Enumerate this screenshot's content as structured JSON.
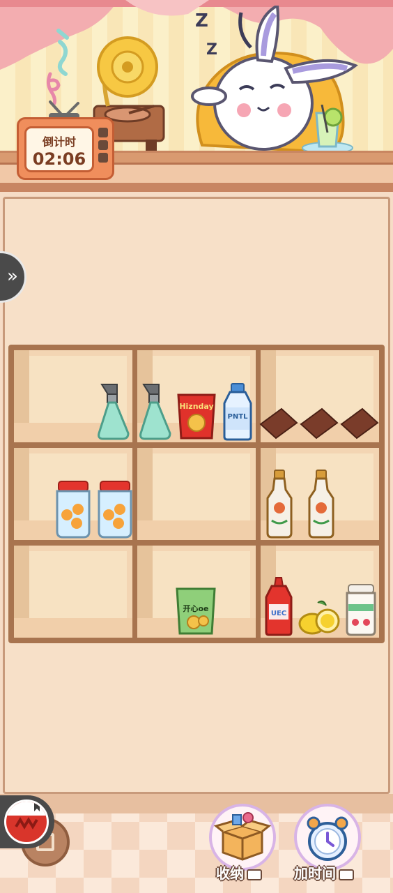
{
  "timer": {
    "label": "倒计时",
    "value": "02:06"
  },
  "shelf_items": {
    "chips_brand": "Hiznday",
    "milk_brand": "PNTL",
    "snack_brand": "开心oe",
    "ketchup_brand": "UEC"
  },
  "tools": {
    "store": {
      "label": "收纳"
    },
    "add_time": {
      "label": "加时间"
    }
  },
  "colors": {
    "shelf_frame": "#a8744f",
    "cell_fill": "#f3d5b3",
    "panel": "#f7e0c8",
    "tv_body": "#f08e5c",
    "curtain": "#f4b0b2"
  }
}
